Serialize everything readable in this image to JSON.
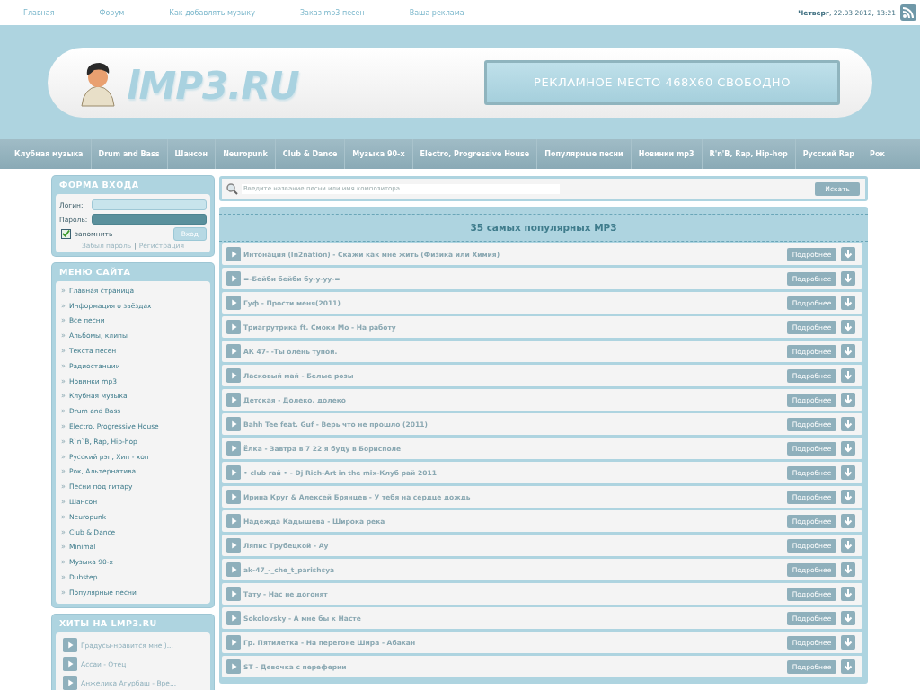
{
  "top_links": [
    "Главная",
    "Форум",
    "Как добавлять музыку",
    "Заказ mp3 песен",
    "Ваша реклама"
  ],
  "date": {
    "weekday": "Четверг",
    "rest": ", 22.03.2012,  13:21"
  },
  "logo": "lMP3.RU",
  "banner": "РЕКЛАМНОЕ МЕСТО 468X60 СВОБОДНО",
  "nav": [
    "Клубная музыка",
    "Drum and Bass",
    "Шансон",
    "Neuropunk",
    "Club & Dance",
    "Музыка 90-х",
    "Electro, Progressive House",
    "Популярные песни",
    "Новинки mp3",
    "R'n'B, Rap, Hip-hop",
    "Русский Rap",
    "Рок"
  ],
  "login": {
    "title": "ФОРМА ВХОДА",
    "login_label": "Логин:",
    "password_label": "Пароль:",
    "remember": {
      "label": "запомнить",
      "checked": true
    },
    "button": "Вход",
    "forgot": "Забыл пароль",
    "separator": "|",
    "register": "Регистрация"
  },
  "menu": {
    "title": "МЕНЮ САЙТА",
    "marker": "»",
    "items": [
      "Главная страница",
      "Информация о звёздах",
      "Все песни",
      "Альбомы, клипы",
      "Текста песен",
      "Радиостанции",
      "Новинки mp3",
      "Клубная музыка",
      "Drum and Bass",
      "Electro, Progressive House",
      "R`n`B, Rap, Hip-hop",
      "Русский рэп, Хип - хоп",
      "Рок, Альтернатива",
      "Песни под гитару",
      "Шансон",
      "Neuropunk",
      "Club & Dance",
      "Minimal",
      "Музыка 90-х",
      "Dubstep",
      "Популярные песни"
    ]
  },
  "hits": {
    "title": "ХИТЫ НА LMP3.RU",
    "items": [
      "Градусы-нравится мне )...",
      "Ассаи - Отец",
      "Анжелика Агурбаш - Вре..."
    ]
  },
  "search": {
    "placeholder": "Введите название песни или имя композитора...",
    "button": "Искать"
  },
  "top_list": {
    "title": "35 самых популярных MP3",
    "rows": [
      {
        "title": "Интонация (In2nation) - Скажи как мне жить (Физика или Химия)",
        "more": "Подробнее"
      },
      {
        "title": "=-Бейби бейби бу-у-уу-=",
        "more": "Подробнее"
      },
      {
        "title": "Гуф - Прости меня(2011)",
        "more": "Подробнее"
      },
      {
        "title": "Триагрутрика ft. Смоки Мо - На работу",
        "more": "Подробнее"
      },
      {
        "title": "АК 47- -Ты олень тупой.",
        "more": "Подробнее"
      },
      {
        "title": "Ласковый май - Белые розы",
        "more": "Подробнее"
      },
      {
        "title": "Детская - Долеко, долеко",
        "more": "Подробнее"
      },
      {
        "title": "Bahh Tee feat. Guf - Верь что не прошло (2011)",
        "more": "Подробнее"
      },
      {
        "title": "Ёлка - Завтра в 7 22 я буду в Борисполе",
        "more": "Подробнее"
      },
      {
        "title": "• club rай • - Dj Rich-Art in the mix-Клуб рай 2011",
        "more": "Подробнее"
      },
      {
        "title": "Ирина Круг & Алексей Брянцев - У тебя на сердце дождь",
        "more": "Подробнее"
      },
      {
        "title": "Надежда Кадышева - Широка река",
        "more": "Подробнее"
      },
      {
        "title": "Ляпис Трубецкой - Ау",
        "more": "Подробнее"
      },
      {
        "title": "ak-47_-_che_t_parishsya",
        "more": "Подробнее"
      },
      {
        "title": "Тату - Нас не догонят",
        "more": "Подробнее"
      },
      {
        "title": "Sokolovsky - А мне бы к Насте",
        "more": "Подробнее"
      },
      {
        "title": "Гр. Пятилетка - На перегоне Шира - Абакан",
        "more": "Подробнее"
      },
      {
        "title": "ST - Девочка с переферии",
        "more": "Подробнее"
      }
    ]
  }
}
